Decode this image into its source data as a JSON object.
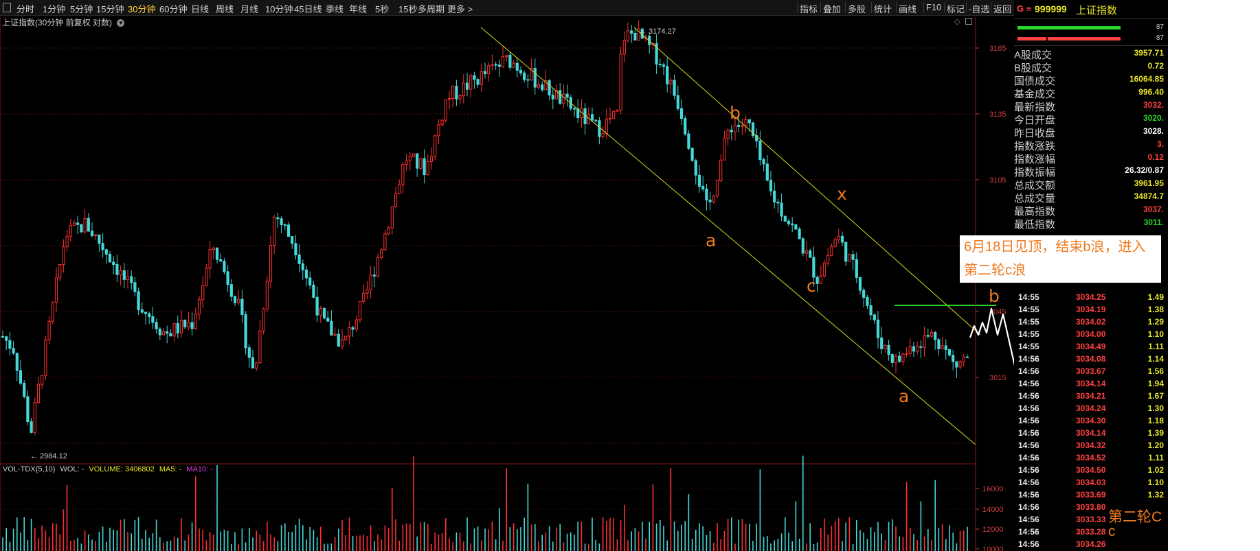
{
  "toolbar": {
    "periods": [
      {
        "label": "分时",
        "active": false
      },
      {
        "label": "1分钟",
        "active": false
      },
      {
        "label": "5分钟",
        "active": false
      },
      {
        "label": "15分钟",
        "active": false
      },
      {
        "label": "30分钟",
        "active": true
      },
      {
        "label": "60分钟",
        "active": false
      },
      {
        "label": "日线",
        "active": false
      },
      {
        "label": "周线",
        "active": false
      },
      {
        "label": "月线",
        "active": false
      },
      {
        "label": "10分钟",
        "active": false
      },
      {
        "label": "45日线",
        "active": false
      },
      {
        "label": "季线",
        "active": false
      },
      {
        "label": "年线",
        "active": false
      },
      {
        "label": "5秒",
        "active": false
      },
      {
        "label": "15秒",
        "active": false
      },
      {
        "label": "多周期",
        "active": false
      },
      {
        "label": "更多 >",
        "active": false
      }
    ],
    "tools": [
      "指标",
      "叠加",
      "多股",
      "统计",
      "画线",
      "F10",
      "标记",
      "-自选",
      "返回"
    ]
  },
  "chart": {
    "title": "上证指数(30分钟 前复权 对数)",
    "high_label": "3174.27",
    "low_label": "2984.12",
    "price_ticks": [
      "3165",
      "3135",
      "3105",
      "3045",
      "3015"
    ],
    "volume_title_prefix": "VOL-TDX(5,10)",
    "volume_wol": "WOL: -",
    "volume_value": "VOLUME: 3406802",
    "volume_ma5": "MA5: -",
    "volume_ma10": "MA10: -",
    "volume_ticks": [
      "16000",
      "14000",
      "12000",
      "10000"
    ]
  },
  "annotations": {
    "note_line1": "6月18日见顶，结束b浪，进入",
    "note_line2": "第二轮c浪",
    "wave_a1": "a",
    "wave_b": "b",
    "wave_x": "x",
    "wave_c": "c",
    "wave_a2": "a",
    "wave_b2": "b",
    "second_c_label": "第二轮C",
    "second_c_small": "c"
  },
  "quote_panel": {
    "code": "999999",
    "name": "上证指数",
    "header_prefix": "G ≡",
    "bar_value_1": "87",
    "bar_value_2": "87",
    "stats": [
      {
        "label": "A股成交",
        "value": "3957.71",
        "color": "#e8e62a"
      },
      {
        "label": "B股成交",
        "value": "0.72",
        "color": "#e8e62a"
      },
      {
        "label": "国债成交",
        "value": "16064.85",
        "color": "#e8e62a"
      },
      {
        "label": "基金成交",
        "value": "996.40",
        "color": "#e8e62a"
      },
      {
        "label": "最新指数",
        "value": "3032.",
        "color": "#ff4040"
      },
      {
        "label": "今日开盘",
        "value": "3020.",
        "color": "#2ad62a"
      },
      {
        "label": "昨日收盘",
        "value": "3028.",
        "color": "#ffffff"
      },
      {
        "label": "指数涨跌",
        "value": "3.",
        "color": "#ff4040"
      },
      {
        "label": "指数涨幅",
        "value": "0.12",
        "color": "#ff4040"
      },
      {
        "label": "指数振幅",
        "value": "26.32/0.87",
        "color": "#ffffff"
      },
      {
        "label": "总成交额",
        "value": "3961.95",
        "color": "#e8e62a"
      },
      {
        "label": "总成交量",
        "value": "34874.7",
        "color": "#e8e62a"
      },
      {
        "label": "最高指数",
        "value": "3037.",
        "color": "#ff4040"
      },
      {
        "label": "最低指数",
        "value": "3011.",
        "color": "#2ad62a"
      }
    ],
    "ticks": [
      {
        "time": "14:55",
        "price": "3034.25",
        "vol": "1.49"
      },
      {
        "time": "14:55",
        "price": "3034.19",
        "vol": "1.38"
      },
      {
        "time": "14:55",
        "price": "3034.02",
        "vol": "1.29"
      },
      {
        "time": "14:55",
        "price": "3034.00",
        "vol": "1.10"
      },
      {
        "time": "14:55",
        "price": "3034.49",
        "vol": "1.11"
      },
      {
        "time": "14:56",
        "price": "3034.08",
        "vol": "1.14"
      },
      {
        "time": "14:56",
        "price": "3033.67",
        "vol": "1.56"
      },
      {
        "time": "14:56",
        "price": "3034.14",
        "vol": "1.94"
      },
      {
        "time": "14:56",
        "price": "3034.21",
        "vol": "1.67"
      },
      {
        "time": "14:56",
        "price": "3034.24",
        "vol": "1.30"
      },
      {
        "time": "14:56",
        "price": "3034.30",
        "vol": "1.18"
      },
      {
        "time": "14:56",
        "price": "3034.14",
        "vol": "1.39"
      },
      {
        "time": "14:56",
        "price": "3034.32",
        "vol": "1.20"
      },
      {
        "time": "14:56",
        "price": "3034.52",
        "vol": "1.11"
      },
      {
        "time": "14:56",
        "price": "3034.50",
        "vol": "1.02"
      },
      {
        "time": "14:56",
        "price": "3034.03",
        "vol": "1.10"
      },
      {
        "time": "14:56",
        "price": "3033.69",
        "vol": "1.32"
      },
      {
        "time": "14:56",
        "price": "3033.80",
        "vol": ""
      },
      {
        "time": "14:56",
        "price": "3033.33",
        "vol": ""
      },
      {
        "time": "14:56",
        "price": "3033.28",
        "vol": ""
      },
      {
        "time": "14:56",
        "price": "3034.26",
        "vol": ""
      }
    ]
  }
}
